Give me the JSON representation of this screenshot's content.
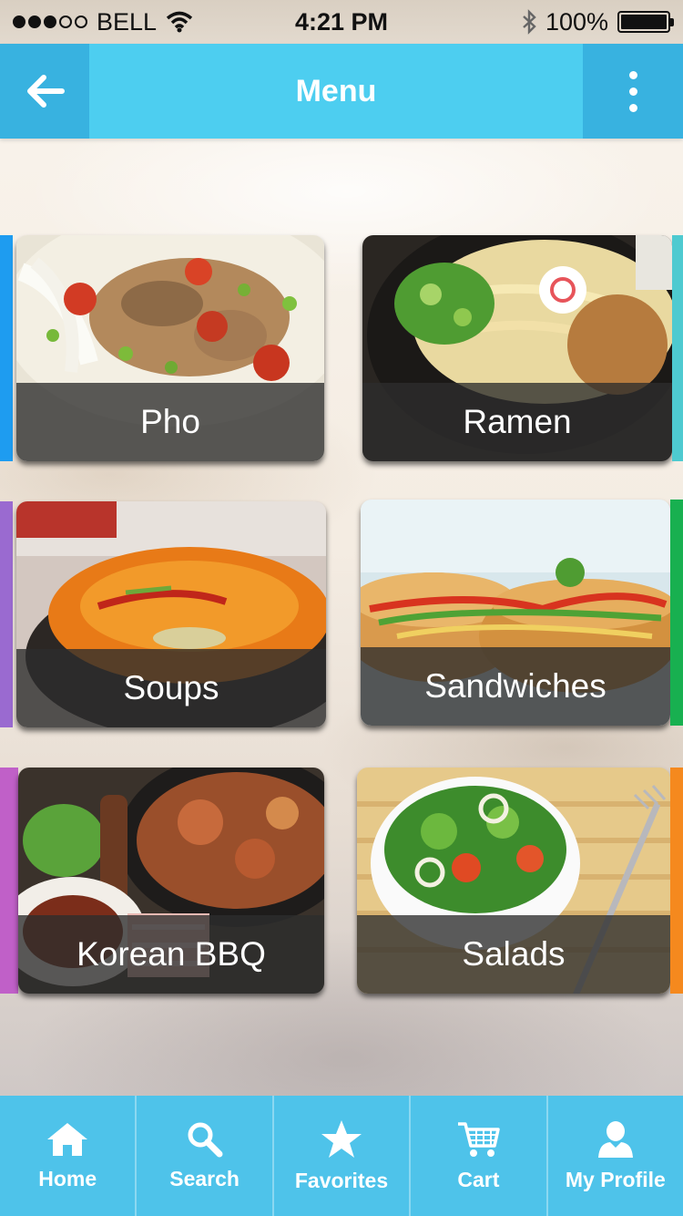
{
  "status_bar": {
    "carrier": "BELL",
    "time": "4:21 PM",
    "battery": "100%",
    "signal_bars_filled": 3,
    "signal_bars_total": 5
  },
  "nav": {
    "title": "Menu",
    "back_icon": "arrow-left-icon",
    "more_icon": "more-vertical-icon",
    "color": "#4dcef0",
    "button_color": "#38b2e0"
  },
  "categories": [
    {
      "label": "Pho",
      "accent": "#1e9cf0",
      "photo": "pho-photo"
    },
    {
      "label": "Ramen",
      "accent": "#4ecad0",
      "photo": "ramen-photo"
    },
    {
      "label": "Soups",
      "accent": "#9a6ad0",
      "photo": "soup-photo"
    },
    {
      "label": "Sandwiches",
      "accent": "#18b050",
      "photo": "sandwich-photo"
    },
    {
      "label": "Korean BBQ",
      "accent": "#c060c8",
      "photo": "bbq-photo"
    },
    {
      "label": "Salads",
      "accent": "#f5891e",
      "photo": "salad-photo"
    }
  ],
  "tabs": [
    {
      "label": "Home",
      "icon": "home-icon"
    },
    {
      "label": "Search",
      "icon": "search-icon"
    },
    {
      "label": "Favorites",
      "icon": "star-icon"
    },
    {
      "label": "Cart",
      "icon": "cart-icon"
    },
    {
      "label": "My Profile",
      "icon": "user-icon"
    }
  ]
}
